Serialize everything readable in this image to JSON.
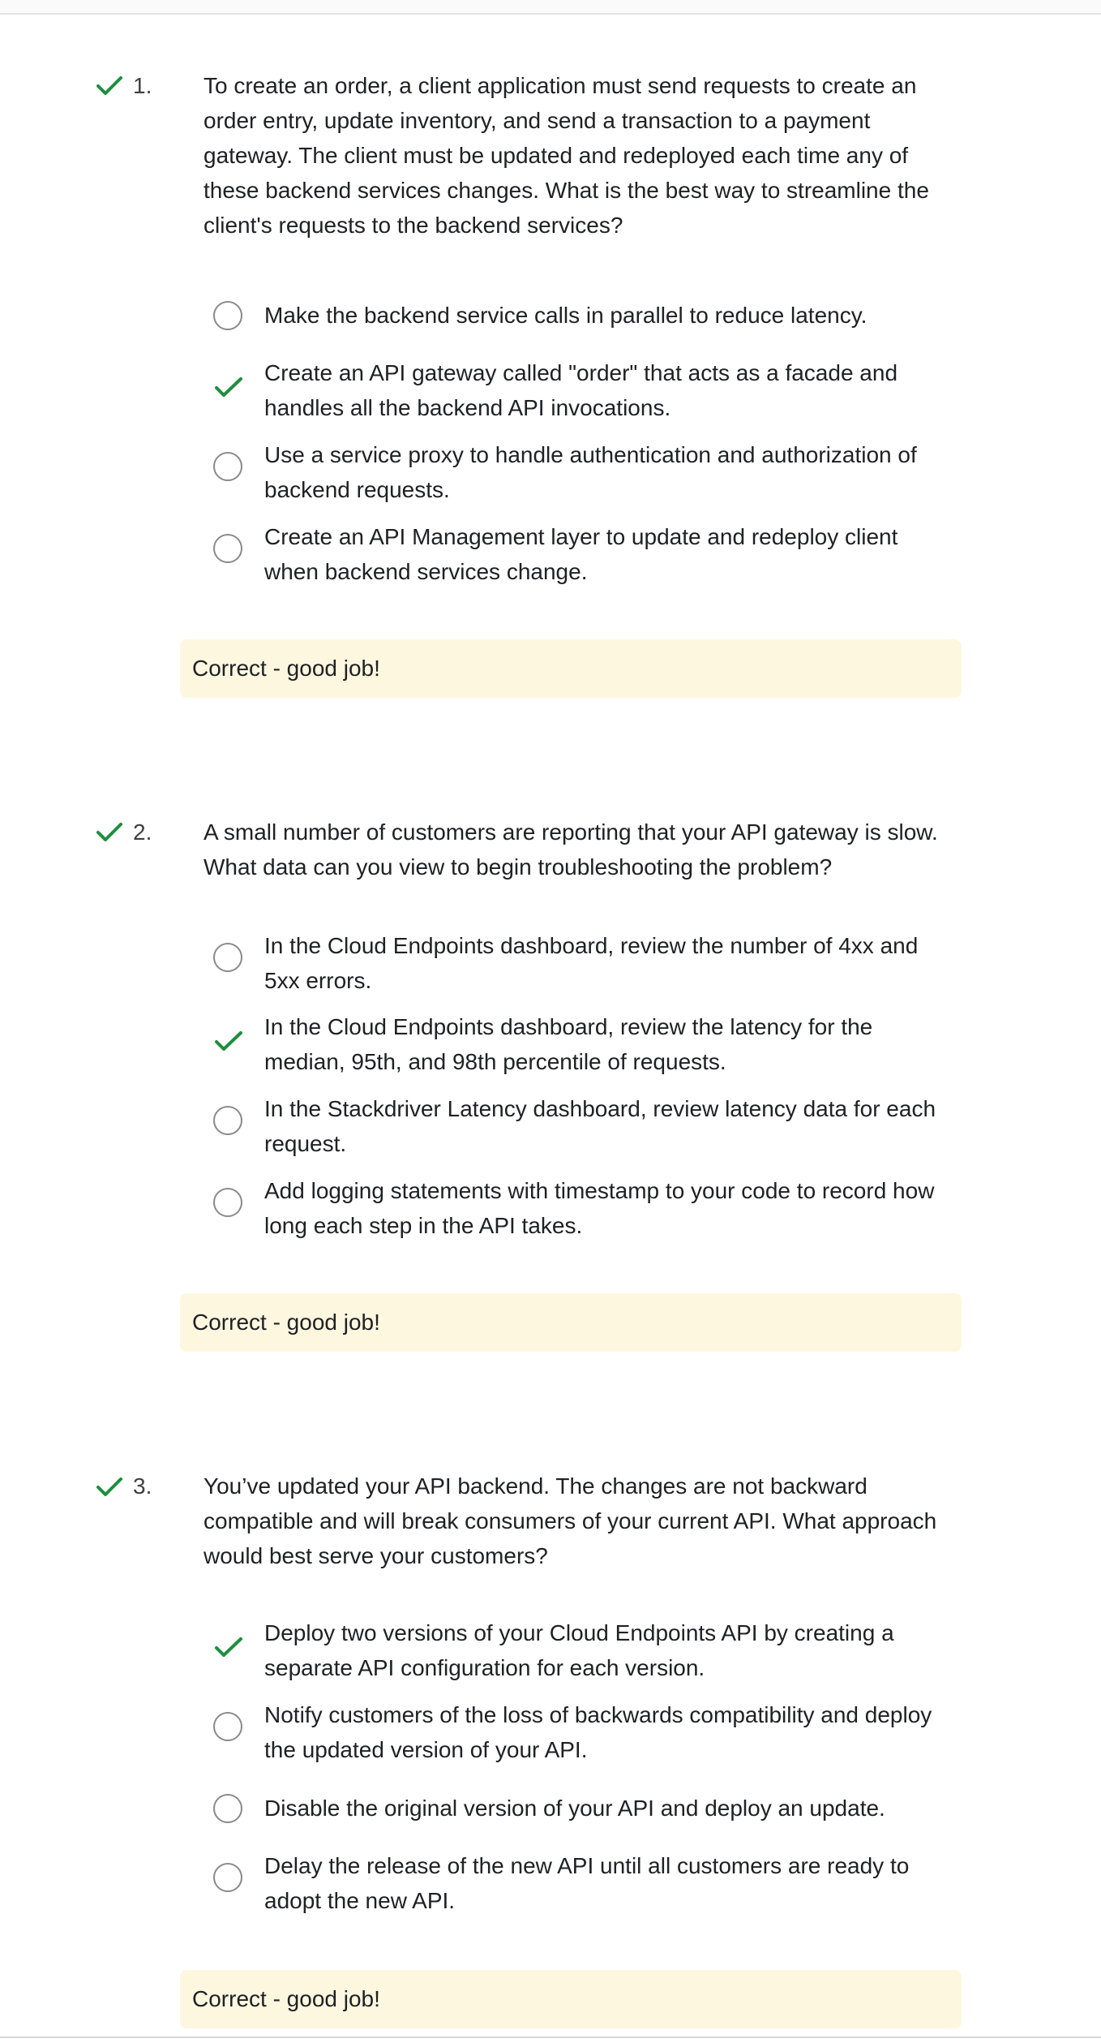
{
  "colors": {
    "correct_green": "#1e8e3e",
    "feedback_background": "#fef7e0",
    "radio_border": "#8a8a8a"
  },
  "questions": [
    {
      "number": "1.",
      "status_icon": "check-icon",
      "text": "To create an order, a client application must send requests to create an order entry, update inventory, and send a transaction to a payment gateway. The client must be updated and redeployed each time any of these backend services changes. What is the best way to streamline the client's requests to the backend services?",
      "options": [
        {
          "label": "Make the backend service calls in parallel to reduce latency.",
          "selected": false
        },
        {
          "label": "Create an API gateway called \"order\" that acts as a facade and handles all the backend API invocations.",
          "selected": true
        },
        {
          "label": "Use a service proxy to handle authentication and authorization of backend requests.",
          "selected": false
        },
        {
          "label": "Create an API Management layer to update and redeploy client when backend services change.",
          "selected": false
        }
      ],
      "feedback": "Correct - good job!"
    },
    {
      "number": "2.",
      "status_icon": "check-icon",
      "text": "A small number of customers are reporting that your API gateway is slow. What data can you view to begin troubleshooting the problem?",
      "options": [
        {
          "label": "In the Cloud Endpoints dashboard, review the number of 4xx and 5xx errors.",
          "selected": false
        },
        {
          "label": "In the Cloud Endpoints dashboard, review the latency for the median, 95th, and 98th percentile of requests.",
          "selected": true
        },
        {
          "label": "In the Stackdriver Latency dashboard, review latency data for each request.",
          "selected": false
        },
        {
          "label": "Add logging statements with timestamp to your code to record how long each step in the API takes.",
          "selected": false
        }
      ],
      "feedback": "Correct - good job!"
    },
    {
      "number": "3.",
      "status_icon": "check-icon",
      "text": "You’ve updated your API backend. The changes are not backward compatible and will break consumers of your current API. What approach would best serve your customers?",
      "options": [
        {
          "label": "Deploy two versions of your Cloud Endpoints API by creating a separate API configuration for each version.",
          "selected": true
        },
        {
          "label": "Notify customers of the loss of backwards compatibility and deploy the updated version of your API.",
          "selected": false
        },
        {
          "label": "Disable the original version of your API and deploy an update.",
          "selected": false
        },
        {
          "label": "Delay the release of the new API until all customers are ready to adopt the new API.",
          "selected": false
        }
      ],
      "feedback": "Correct - good job!"
    }
  ]
}
